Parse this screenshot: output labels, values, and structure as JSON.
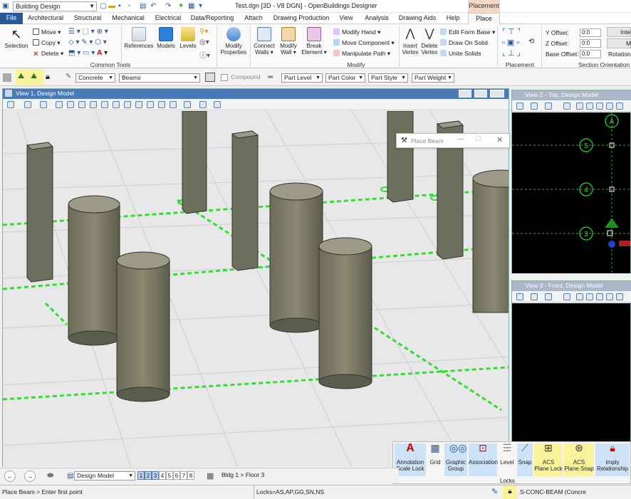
{
  "titlebar": {
    "workspace": "Building Design",
    "title": "Test.dgn [3D - V8 DGN] - OpenBuildings Designer",
    "context_tab": "Placement"
  },
  "tabs": [
    "File",
    "Architectural",
    "Structural",
    "Mechanical",
    "Electrical",
    "Data/Reporting",
    "Attach",
    "Drawing Production",
    "View",
    "Analysis",
    "Drawing Aids",
    "Help",
    "Place"
  ],
  "ribbon": {
    "selection": "Selection",
    "move": "Move",
    "copy": "Copy",
    "delete": "Delete",
    "common_tools": "Common Tools",
    "references": "References",
    "models": "Models",
    "levels": "Levels",
    "modify_properties": [
      "Modify",
      "Properties"
    ],
    "connect_walls": [
      "Connect",
      "Walls"
    ],
    "modify_wall": [
      "Modify",
      "Wall"
    ],
    "break_element": [
      "Break",
      "Element"
    ],
    "modify_hand": "Modify Hand",
    "move_component": "Move Component",
    "manipulate_path": "Manipulate Path",
    "modify": "Modify",
    "insert_vertex": [
      "Insert",
      "Vertex"
    ],
    "delete_vertex": [
      "Delete",
      "Vertex"
    ],
    "edit_form_base": "Edit Form Base",
    "draw_on_solid": "Draw On Solid",
    "unite_solids": "Unite Solids",
    "placement": "Placement",
    "y_offset_label": "Y Offset:",
    "z_offset_label": "Z Offset:",
    "base_offset_label": "Base Offset:",
    "y_offset": "0:0",
    "z_offset": "0:0",
    "base_offset": "0:0",
    "inte": "Inte",
    "m": "M",
    "rotation": "Rotation",
    "section_orientation": "Section Orientation"
  },
  "attrbar": {
    "material": "Concrete",
    "family": "Beams",
    "compound": "Compound",
    "part_level": "Part Level",
    "part_color": "Part Color",
    "part_style": "Part Style",
    "part_weight": "Part Weight"
  },
  "views": {
    "view1": "View 1, Design Model",
    "view2": "View 2 - Top, Design Model",
    "view3": "View 3 - Front, Design Model"
  },
  "grid_labels": [
    "A",
    "5",
    "4",
    "3"
  ],
  "dialog": {
    "title": "Place Beam"
  },
  "viewctl": {
    "model": "Design Model",
    "view_numbers": [
      "1",
      "2",
      "3",
      "4",
      "5",
      "6",
      "7",
      "8"
    ],
    "floor": "Bldg 1 > Floor 3"
  },
  "status_panel": {
    "annotation_scale_lock": [
      "Annotation",
      "Scale Lock"
    ],
    "grid": "Grid",
    "graphic_group": [
      "Graphic",
      "Group"
    ],
    "association": "Association",
    "level": "Level",
    "snap": "Snap",
    "acs_plane_lock": [
      "ACS",
      "Plane Lock"
    ],
    "acs_plane_snap": [
      "ACS",
      "Plane Snap"
    ],
    "imply_relationship": [
      "Imply",
      "Relationship"
    ],
    "locks": "Locks"
  },
  "status": {
    "prompt": "Place Beam > Enter first point",
    "locks": "Locks=AS,AP,GG,SN,NS",
    "active_level": "S-CONC-BEAM (Concre"
  },
  "colors": {
    "file_tab": "#2b5797",
    "context_tab": "#f6d7c4",
    "highlight": "#fbf39b",
    "grid_green": "#00ee00"
  }
}
